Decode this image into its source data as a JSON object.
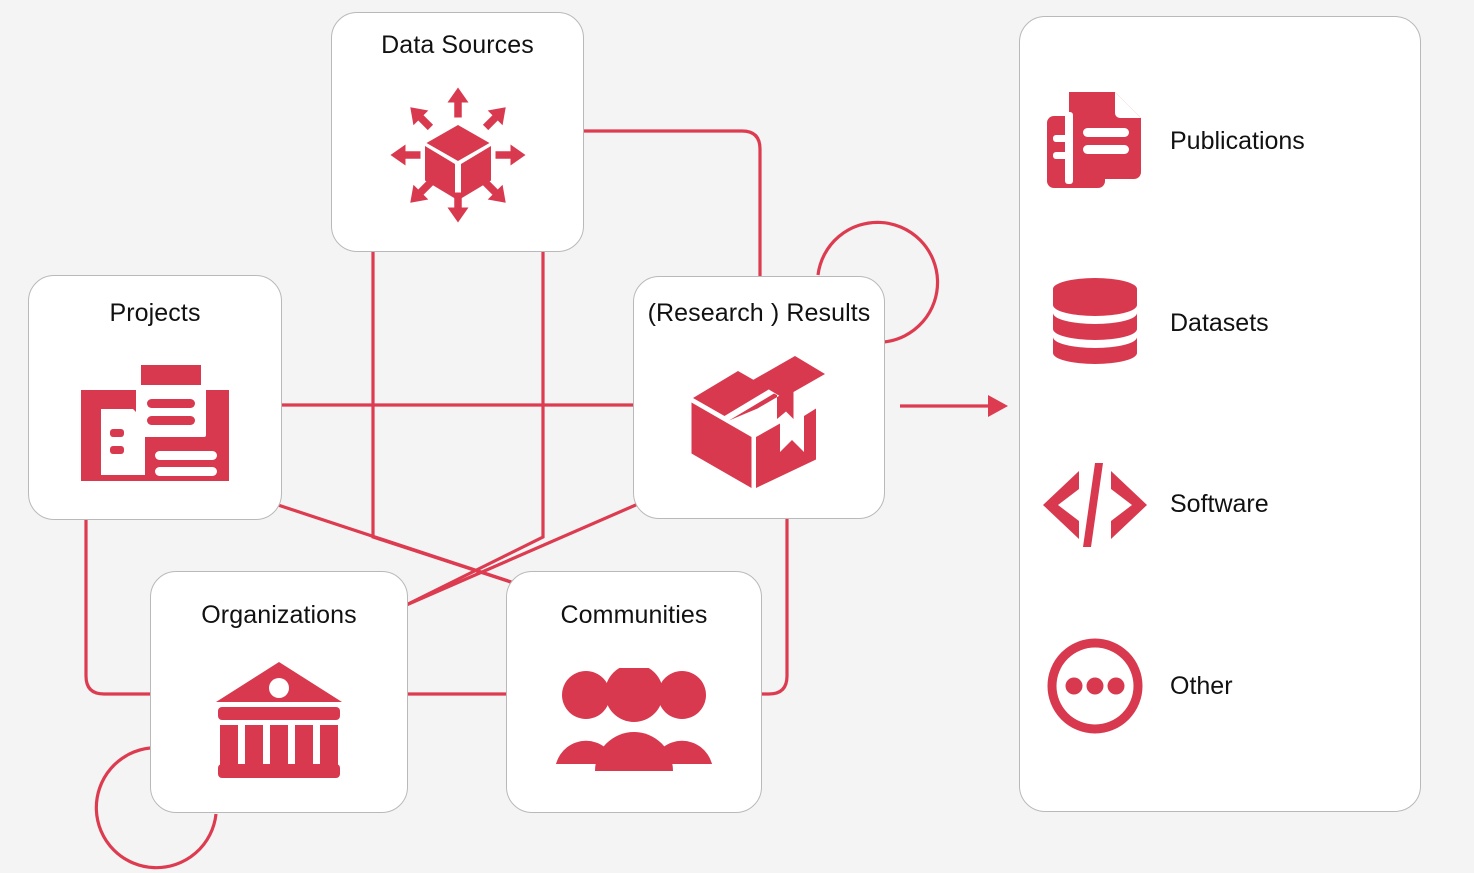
{
  "theme": {
    "accent": "#D8394E",
    "connector": "#DD3B50",
    "card_bg": "#FFFFFF",
    "card_border": "#B9B9B9",
    "page_bg": "#F4F4F4",
    "text": "#111111"
  },
  "entities": [
    {
      "id": "data-sources",
      "label": "Data Sources",
      "icon": "cube-distribute-icon"
    },
    {
      "id": "projects",
      "label": "Projects",
      "icon": "project-documents-icon"
    },
    {
      "id": "results",
      "label": "(Research ) Results",
      "icon": "open-box-icon"
    },
    {
      "id": "organizations",
      "label": "Organizations",
      "icon": "institution-icon"
    },
    {
      "id": "communities",
      "label": "Communities",
      "icon": "people-group-icon"
    }
  ],
  "outputs": {
    "items": [
      {
        "id": "publications",
        "label": "Publications",
        "icon": "documents-stack-icon"
      },
      {
        "id": "datasets",
        "label": "Datasets",
        "icon": "database-cylinder-icon"
      },
      {
        "id": "software",
        "label": "Software",
        "icon": "code-brackets-icon"
      },
      {
        "id": "other",
        "label": "Other",
        "icon": "ellipsis-circle-icon"
      }
    ]
  },
  "connections": [
    {
      "from": "data-sources",
      "to": "results",
      "style": "elbow"
    },
    {
      "from": "data-sources",
      "to": "organizations",
      "style": "vertical-diagonal"
    },
    {
      "from": "data-sources",
      "to": "communities",
      "style": "vertical-diagonal"
    },
    {
      "from": "projects",
      "to": "results",
      "style": "horizontal"
    },
    {
      "from": "projects",
      "to": "organizations",
      "style": "elbow"
    },
    {
      "from": "projects",
      "to": "communities",
      "style": "diagonal"
    },
    {
      "from": "results",
      "to": "organizations",
      "style": "diagonal"
    },
    {
      "from": "results",
      "to": "communities",
      "style": "elbow"
    },
    {
      "from": "organizations",
      "to": "communities",
      "style": "horizontal"
    },
    {
      "from": "results",
      "to": "results",
      "style": "self-loop"
    },
    {
      "from": "organizations",
      "to": "organizations",
      "style": "self-loop"
    },
    {
      "from": "results",
      "to": "outputs",
      "style": "arrow"
    }
  ]
}
